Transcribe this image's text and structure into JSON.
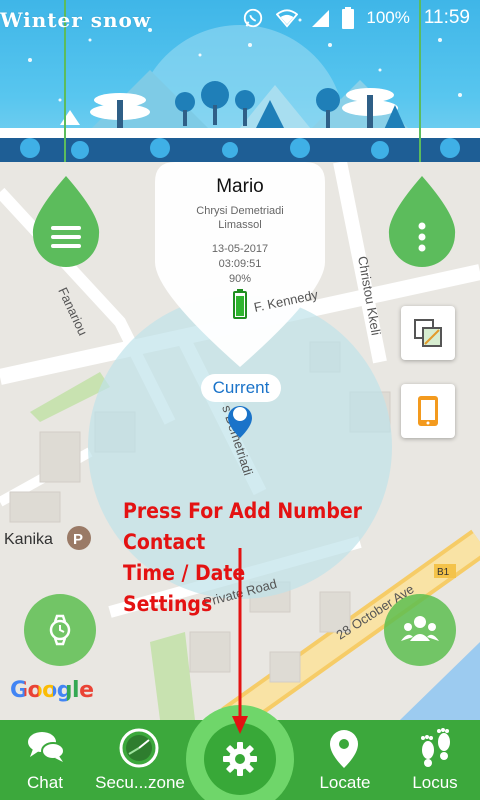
{
  "status_bar": {
    "app_title": "Winter snow",
    "battery_pct": "100%",
    "time": "11:59",
    "icons": [
      "whatsapp-icon",
      "wifi-icon",
      "signal-icon",
      "battery-icon"
    ]
  },
  "banner": {
    "theme": "winter-landscape"
  },
  "map": {
    "street_labels": [
      "Christou Kkeli",
      "Fanariou",
      "F. Kennedy",
      "s Demetriadi",
      "Private Road",
      "28 October Ave",
      "B1"
    ],
    "poi": {
      "name": "Kanika",
      "badge": "P"
    },
    "google_logo": "Google"
  },
  "marker": {
    "name": "Mario",
    "address_line1": "Chrysi Demetriadi",
    "address_line2": "Limassol",
    "date": "13-05-2017",
    "time": "03:09:51",
    "battery": "90%",
    "current_label": "Current"
  },
  "annotation": {
    "lines": [
      "Press For Add Number",
      "Contact",
      "Time / Date",
      "Settings"
    ],
    "color": "#e41212"
  },
  "bottom_nav": {
    "items": [
      {
        "label": "Chat",
        "icon": "chat-bubbles-icon"
      },
      {
        "label": "Secu...zone",
        "icon": "radar-icon"
      },
      {
        "label": "",
        "icon": "gear-icon"
      },
      {
        "label": "Locate",
        "icon": "location-pin-icon"
      },
      {
        "label": "Locus",
        "icon": "footprints-icon"
      }
    ],
    "background": "#3ca83c"
  },
  "colors": {
    "accent_green": "#5cbc5c",
    "map_circle": "#bfe3ea",
    "current_blue": "#1a73c9"
  }
}
